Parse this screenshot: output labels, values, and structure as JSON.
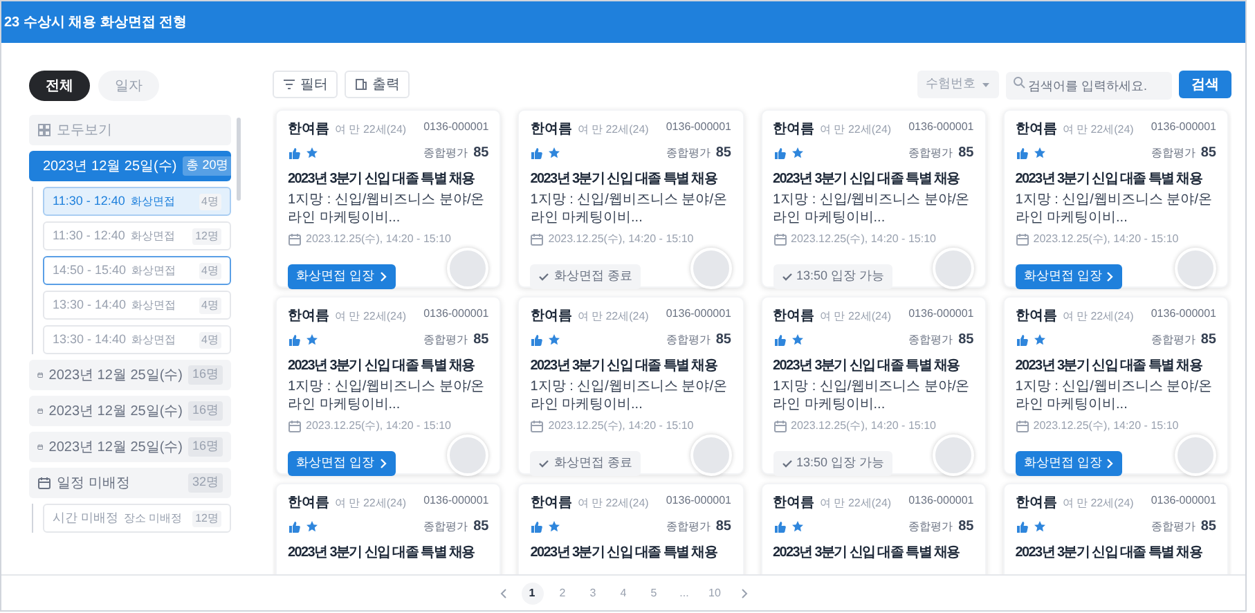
{
  "header": {
    "title": "23 수상시 채용 화상면접 전형"
  },
  "view_tabs": [
    {
      "label": "전체",
      "selected": true
    },
    {
      "label": "일자",
      "selected": false
    }
  ],
  "sidebar": {
    "items": [
      {
        "kind": "all",
        "label": "모두보기",
        "selected": false
      },
      {
        "kind": "date",
        "label": "2023년 12월 25일(수)",
        "count": "총 20명",
        "selected": true,
        "children": [
          {
            "time": "11:30 - 12:40",
            "type": "화상면접",
            "count": "4명",
            "selected": true,
            "focused": false
          },
          {
            "time": "11:30 - 12:40",
            "type": "화상면접",
            "count": "12명",
            "selected": false,
            "focused": false
          },
          {
            "time": "14:50 - 15:40",
            "type": "화상면접",
            "count": "4명",
            "selected": false,
            "focused": true
          },
          {
            "time": "13:30 - 14:40",
            "type": "화상면접",
            "count": "4명",
            "selected": false,
            "focused": false
          },
          {
            "time": "13:30 - 14:40",
            "type": "화상면접",
            "count": "4명",
            "selected": false,
            "focused": false
          }
        ]
      },
      {
        "kind": "date",
        "label": "2023년 12월 25일(수)",
        "count": "16명",
        "selected": false
      },
      {
        "kind": "date",
        "label": "2023년 12월 25일(수)",
        "count": "16명",
        "selected": false
      },
      {
        "kind": "date",
        "label": "2023년 12월 25일(수)",
        "count": "16명",
        "selected": false
      },
      {
        "kind": "date",
        "label": "일정 미배정",
        "count": "32명",
        "selected": false,
        "children": [
          {
            "time": "시간 미배정",
            "type": "장소 미배정",
            "count": "12명",
            "selected": false,
            "focused": false
          }
        ]
      }
    ]
  },
  "toolbar": {
    "buttons": [
      "필터",
      "출력"
    ],
    "filter_select": "수험번호",
    "search_placeholder": "검색어를 입력하세요.",
    "search_button": "검색"
  },
  "cards": [
    {
      "name": "한여름",
      "info": "여 만 22세(24)",
      "id": "0136-000001",
      "score_label": "종합평가",
      "score": "85",
      "title": "2023년 3분기 신입 대졸 특별 채용",
      "position": "1지망 : 신입/웹비즈니스 분야/온라인 마케팅이비...",
      "date": "2023.12.25(수), 14:20 - 15:10",
      "action": {
        "kind": "enter",
        "label": "화상면접 입장"
      }
    },
    {
      "name": "한여름",
      "info": "여 만 22세(24)",
      "id": "0136-000001",
      "score_label": "종합평가",
      "score": "85",
      "title": "2023년 3분기 신입 대졸 특별 채용",
      "position": "1지망 : 신입/웹비즈니스 분야/온라인 마케팅이비...",
      "date": "2023.12.25(수), 14:20 - 15:10",
      "action": {
        "kind": "done",
        "label": "화상면접 종료"
      }
    },
    {
      "name": "한여름",
      "info": "여 만 22세(24)",
      "id": "0136-000001",
      "score_label": "종합평가",
      "score": "85",
      "title": "2023년 3분기 신입 대졸 특별 채용",
      "position": "1지망 : 신입/웹비즈니스 분야/온라인 마케팅이비...",
      "date": "2023.12.25(수), 14:20 - 15:10",
      "action": {
        "kind": "wait",
        "label": "13:50 입장 가능"
      }
    },
    {
      "name": "한여름",
      "info": "여 만 22세(24)",
      "id": "0136-000001",
      "score_label": "종합평가",
      "score": "85",
      "title": "2023년 3분기 신입 대졸 특별 채용",
      "position": "1지망 : 신입/웹비즈니스 분야/온라인 마케팅이비...",
      "date": "2023.12.25(수), 14:20 - 15:10",
      "action": {
        "kind": "enter",
        "label": "화상면접 입장"
      }
    },
    {
      "name": "한여름",
      "info": "여 만 22세(24)",
      "id": "0136-000001",
      "score_label": "종합평가",
      "score": "85",
      "title": "2023년 3분기 신입 대졸 특별 채용",
      "position": "1지망 : 신입/웹비즈니스 분야/온라인 마케팅이비...",
      "date": "2023.12.25(수), 14:20 - 15:10",
      "action": {
        "kind": "enter",
        "label": "화상면접 입장"
      }
    },
    {
      "name": "한여름",
      "info": "여 만 22세(24)",
      "id": "0136-000001",
      "score_label": "종합평가",
      "score": "85",
      "title": "2023년 3분기 신입 대졸 특별 채용",
      "position": "1지망 : 신입/웹비즈니스 분야/온라인 마케팅이비...",
      "date": "2023.12.25(수), 14:20 - 15:10",
      "action": {
        "kind": "done",
        "label": "화상면접 종료"
      }
    },
    {
      "name": "한여름",
      "info": "여 만 22세(24)",
      "id": "0136-000001",
      "score_label": "종합평가",
      "score": "85",
      "title": "2023년 3분기 신입 대졸 특별 채용",
      "position": "1지망 : 신입/웹비즈니스 분야/온라인 마케팅이비...",
      "date": "2023.12.25(수), 14:20 - 15:10",
      "action": {
        "kind": "wait",
        "label": "13:50 입장 가능"
      }
    },
    {
      "name": "한여름",
      "info": "여 만 22세(24)",
      "id": "0136-000001",
      "score_label": "종합평가",
      "score": "85",
      "title": "2023년 3분기 신입 대졸 특별 채용",
      "position": "1지망 : 신입/웹비즈니스 분야/온라인 마케팅이비...",
      "date": "2023.12.25(수), 14:20 - 15:10",
      "action": {
        "kind": "enter",
        "label": "화상면접 입장"
      }
    },
    {
      "name": "한여름",
      "info": "여 만 22세(24)",
      "id": "0136-000001",
      "score_label": "종합평가",
      "score": "85",
      "title": "2023년 3분기 신입 대졸 특별 채용"
    },
    {
      "name": "한여름",
      "info": "여 만 22세(24)",
      "id": "0136-000001",
      "score_label": "종합평가",
      "score": "85",
      "title": "2023년 3분기 신입 대졸 특별 채용"
    },
    {
      "name": "한여름",
      "info": "여 만 22세(24)",
      "id": "0136-000001",
      "score_label": "종합평가",
      "score": "85",
      "title": "2023년 3분기 신입 대졸 특별 채용"
    },
    {
      "name": "한여름",
      "info": "여 만 22세(24)",
      "id": "0136-000001",
      "score_label": "종합평가",
      "score": "85",
      "title": "2023년 3분기 신입 대졸 특별 채용"
    }
  ],
  "pagination": {
    "pages": [
      {
        "label": "1",
        "selected": true
      },
      {
        "label": "2",
        "selected": false
      },
      {
        "label": "3",
        "selected": false
      },
      {
        "label": "4",
        "selected": false
      },
      {
        "label": "5",
        "selected": false
      },
      {
        "label": "...",
        "selected": false
      },
      {
        "label": "10",
        "selected": false
      }
    ]
  }
}
